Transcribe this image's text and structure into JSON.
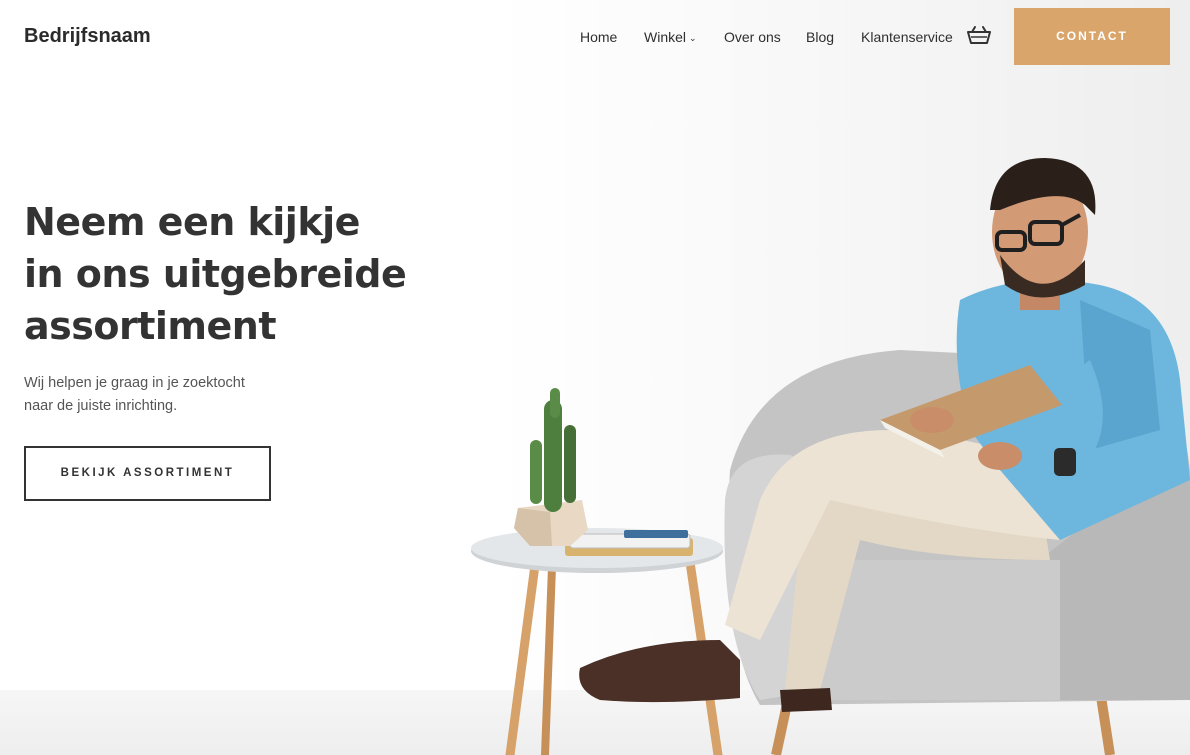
{
  "header": {
    "brand": "Bedrijfsnaam",
    "nav": [
      {
        "label": "Home"
      },
      {
        "label": "Winkel",
        "has_dropdown": true
      },
      {
        "label": "Over ons"
      },
      {
        "label": "Blog"
      },
      {
        "label": "Klantenservice"
      }
    ],
    "cart_icon": "basket-icon",
    "contact_label": "CONTACT"
  },
  "hero": {
    "title_lines": [
      "Neem een kijkje",
      "in ons uitgebreide",
      "assortiment"
    ],
    "subtitle_lines": [
      "Wij helpen je graag in je zoektocht",
      "naar de juiste inrichting."
    ],
    "cta_label": "BEKIJK ASSORTIMENT"
  },
  "colors": {
    "accent": "#daa56a",
    "text_dark": "#333333",
    "shirt": "#6db6dd",
    "chair": "#c9c9c9",
    "pants": "#e6dccb",
    "notebook": "#c49a6c"
  }
}
